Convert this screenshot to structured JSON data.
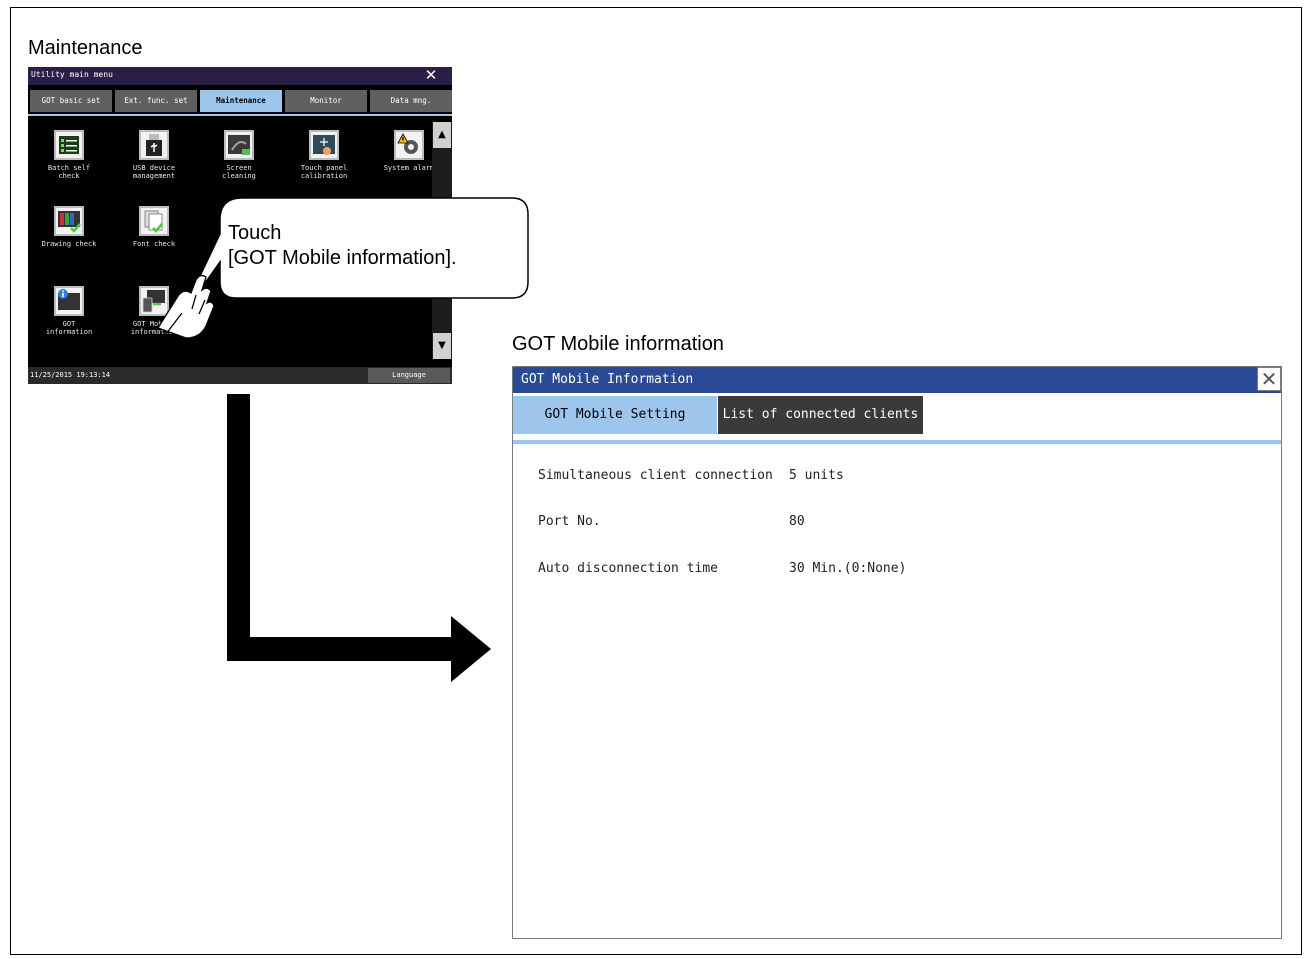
{
  "maintenance_heading": "Maintenance",
  "got_mobile_heading": "GOT Mobile information",
  "callout": {
    "line1": "Touch",
    "line2": "[GOT Mobile information]."
  },
  "utility": {
    "title": "Utility main menu",
    "tabs": [
      {
        "label": "GOT basic set"
      },
      {
        "label": "Ext. func. set"
      },
      {
        "label": "Maintenance"
      },
      {
        "label": "Monitor"
      },
      {
        "label": "Data mng."
      }
    ],
    "icons": [
      {
        "label": "Batch self\ncheck",
        "icon": "batch-self-check-icon"
      },
      {
        "label": "USB device\nmanagement",
        "icon": "usb-device-icon"
      },
      {
        "label": "Screen\ncleaning",
        "icon": "screen-cleaning-icon"
      },
      {
        "label": "Touch panel\ncalibration",
        "icon": "touch-panel-calibration-icon"
      },
      {
        "label": "System alarm",
        "icon": "system-alarm-icon"
      },
      {
        "label": "Drawing check",
        "icon": "drawing-check-icon"
      },
      {
        "label": "Font check",
        "icon": "font-check-icon"
      },
      {
        "label": "GOT\ninformation",
        "icon": "got-information-icon"
      },
      {
        "label": "GOT Mobile\ninformation",
        "icon": "got-mobile-information-icon"
      }
    ],
    "datetime": "11/25/2015 19:13:14",
    "language_label": "Language"
  },
  "got_mobile": {
    "title": "GOT Mobile Information",
    "tabs": [
      {
        "label": "GOT Mobile Setting"
      },
      {
        "label": "List of connected clients"
      }
    ],
    "rows": [
      {
        "label": "Simultaneous client connection",
        "value": "5 units"
      },
      {
        "label": "Port No.",
        "value": "80"
      },
      {
        "label": "Auto disconnection time",
        "value": "30 Min.(0:None)"
      }
    ]
  },
  "colors": {
    "utility_titlebar": "#2a1f47",
    "active_tab": "#9ec6ec",
    "got_titlebar": "#2b4a95",
    "inactive_tab": "#3a3a3a"
  }
}
